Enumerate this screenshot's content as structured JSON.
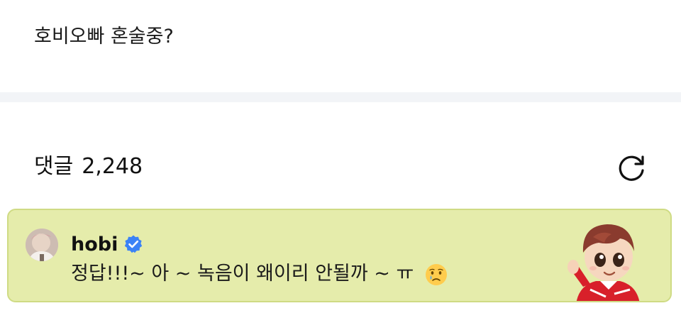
{
  "post": {
    "text": "호비오빠 혼술중?"
  },
  "comments": {
    "label": "댓글",
    "count": "2,248",
    "refresh_icon": "refresh-icon"
  },
  "pinned_comment": {
    "author": "hobi",
    "verified_icon": "verified-badge-icon",
    "body": "정답!!!~ 아 ~ 녹음이 왜이리 안될까 ~ ㅠ",
    "emoji_icon": "crying-face-icon",
    "sticker_icon": "character-sticker-icon"
  },
  "colors": {
    "card_background": "#e5ecab",
    "card_border": "#cfdb84",
    "verified": "#3b82f6",
    "divider": "#f2f4f7"
  }
}
